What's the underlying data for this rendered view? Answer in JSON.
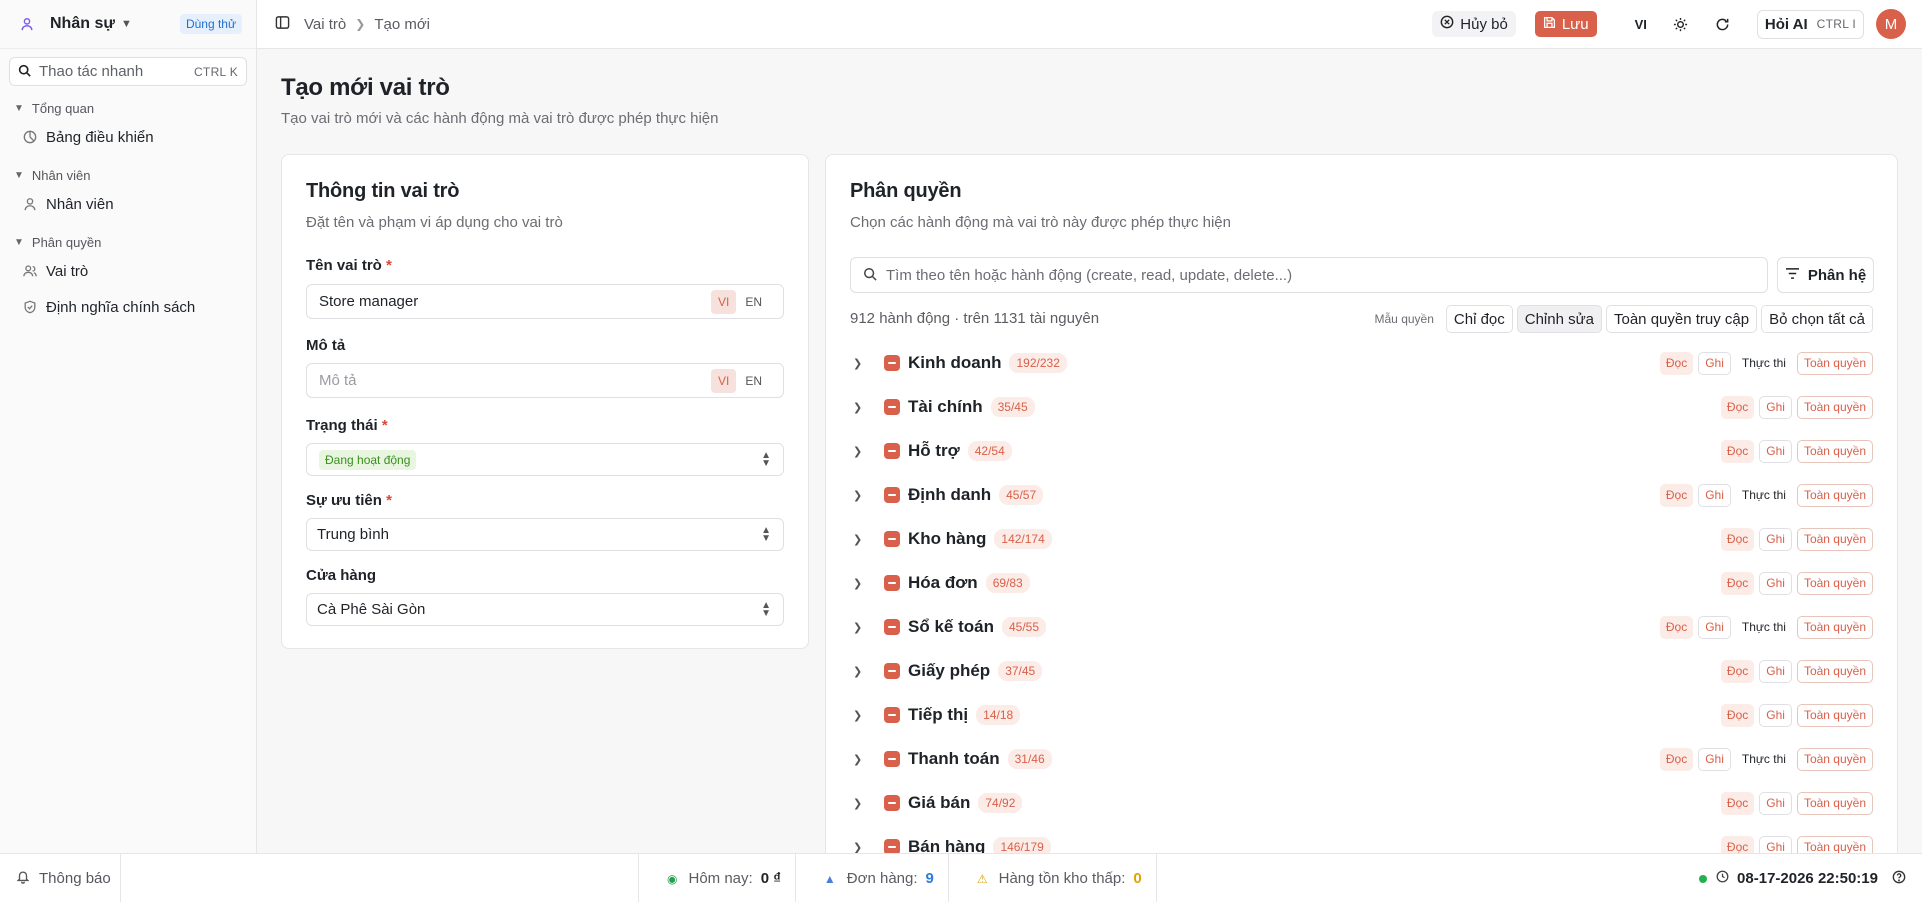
{
  "app": {
    "name": "Nhân sự",
    "trial_badge": "Dùng thử"
  },
  "sidebar": {
    "search": {
      "placeholder": "Thao tác nhanh",
      "shortcut": "CTRL K"
    },
    "groups": [
      {
        "label": "Tổng quan",
        "items": [
          {
            "label": "Bảng điều khiển",
            "icon": "dashboard-icon"
          }
        ]
      },
      {
        "label": "Nhân viên",
        "items": [
          {
            "label": "Nhân viên",
            "icon": "user-icon"
          }
        ]
      },
      {
        "label": "Phân quyền",
        "items": [
          {
            "label": "Vai trò",
            "icon": "users-icon"
          },
          {
            "label": "Định nghĩa chính sách",
            "icon": "shield-icon"
          }
        ]
      }
    ]
  },
  "header": {
    "breadcrumb": [
      "Vai trò",
      "Tạo mới"
    ],
    "cancel_label": "Hủy bỏ",
    "save_label": "Lưu",
    "lang": "VI",
    "ai_label": "Hỏi AI",
    "ai_shortcut": "CTRL I",
    "avatar_initial": "M"
  },
  "page": {
    "title": "Tạo mới vai trò",
    "subtitle": "Tạo vai trò mới và các hành động mà vai trò được phép thực hiện"
  },
  "info_card": {
    "title": "Thông tin vai trò",
    "subtitle": "Đặt tên và phạm vi áp dụng cho vai trò",
    "name_label": "Tên vai trò",
    "name_value": "Store manager",
    "desc_label": "Mô tả",
    "desc_placeholder": "Mô tả",
    "lang_vi": "VI",
    "lang_en": "EN",
    "status_label": "Trạng thái",
    "status_value": "Đang hoạt động",
    "priority_label": "Sự ưu tiên",
    "priority_value": "Trung bình",
    "store_label": "Cửa hàng",
    "store_value": "Cà Phê Sài Gòn",
    "required_mark": "*"
  },
  "perm_card": {
    "title": "Phân quyền",
    "subtitle": "Chọn các hành động mà vai trò này được phép thực hiện",
    "search_placeholder": "Tìm theo tên hoặc hành động (create, read, update, delete...)",
    "module_button": "Phân hệ",
    "count_text": "912 hành động · trên 1131 tài nguyên",
    "presets_label": "Mẫu quyền",
    "presets": [
      "Chỉ đọc",
      "Chỉnh sửa",
      "Toàn quyền truy cập",
      "Bỏ chọn tất cả"
    ],
    "action_labels": {
      "read": "Đọc",
      "write": "Ghi",
      "exec": "Thực thi",
      "full": "Toàn quyền"
    },
    "modules": [
      {
        "name": "Kinh doanh",
        "count": "192/232",
        "exec": true
      },
      {
        "name": "Tài chính",
        "count": "35/45",
        "exec": false
      },
      {
        "name": "Hỗ trợ",
        "count": "42/54",
        "exec": false
      },
      {
        "name": "Định danh",
        "count": "45/57",
        "exec": true
      },
      {
        "name": "Kho hàng",
        "count": "142/174",
        "exec": false
      },
      {
        "name": "Hóa đơn",
        "count": "69/83",
        "exec": false
      },
      {
        "name": "Sổ kế toán",
        "count": "45/55",
        "exec": true
      },
      {
        "name": "Giấy phép",
        "count": "37/45",
        "exec": false
      },
      {
        "name": "Tiếp thị",
        "count": "14/18",
        "exec": false
      },
      {
        "name": "Thanh toán",
        "count": "31/46",
        "exec": true
      },
      {
        "name": "Giá bán",
        "count": "74/92",
        "exec": false
      },
      {
        "name": "Bán hàng",
        "count": "146/179",
        "exec": false
      }
    ]
  },
  "footer": {
    "notifications": "Thông báo",
    "today_label": "Hôm nay:",
    "today_value": "0 ₫",
    "orders_label": "Đơn hàng:",
    "orders_value": "9",
    "low_stock_label": "Hàng tồn kho thấp:",
    "low_stock_value": "0",
    "datetime": "08-17-2026 22:50:19"
  },
  "colors": {
    "accent": "#d9604a",
    "trial": "#1f6fd6",
    "status_ok": "#3c8f21",
    "online": "#22b14c"
  }
}
